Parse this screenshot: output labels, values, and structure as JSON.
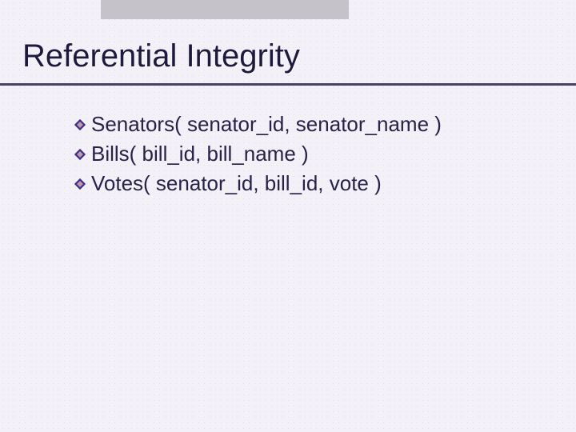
{
  "title": "Referential Integrity",
  "bullets": [
    "Senators( senator_id, senator_name )",
    "Bills( bill_id, bill_name )",
    "Votes( senator_id, bill_id, vote )"
  ]
}
